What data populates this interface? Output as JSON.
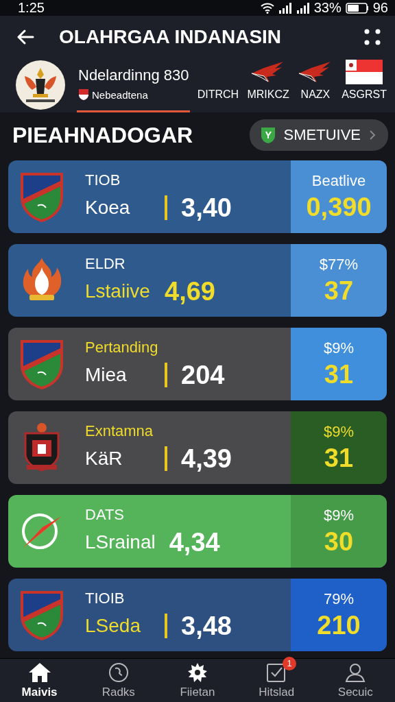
{
  "status_bar": {
    "time": "1:25",
    "battery": "33%",
    "extra": "96"
  },
  "header": {
    "title": "OLAHRGAA INDANASIN"
  },
  "tabs": [
    {
      "title": "Ndelardinng 830",
      "label": "Nebeadtena",
      "selected": true
    },
    {
      "label": "DITRCH",
      "selected": false
    },
    {
      "label": "MRIKCZ",
      "selected": false
    },
    {
      "label": "NAZX",
      "selected": false
    },
    {
      "label": "ASGRST",
      "selected": false
    }
  ],
  "section": {
    "title": "PIEAHNADOGAR",
    "button": "SMETUIVE"
  },
  "rows": [
    {
      "kind": "shield",
      "label": "TIOB",
      "name": "Koea",
      "score": "3,40",
      "color": "#2e5a8e",
      "divider": true,
      "label_highlight": false,
      "name_highlight": false,
      "score_highlight": false,
      "odds": {
        "label": "Beatlive",
        "value": "0,390",
        "color": "#4a8fd4",
        "label_highlight": false
      }
    },
    {
      "kind": "flame",
      "label": "ELDR",
      "name": "Lstaiive",
      "score": "4,69",
      "color": "#2e5a8e",
      "divider": false,
      "label_highlight": false,
      "name_highlight": true,
      "score_highlight": true,
      "odds": {
        "label": "$77%",
        "value": "37",
        "color": "#4a8fd4",
        "label_highlight": false
      }
    },
    {
      "kind": "shield",
      "label": "Pertanding",
      "name": "Miea",
      "score": "204",
      "color": "#4a4a4c",
      "divider": true,
      "label_highlight": true,
      "name_highlight": false,
      "score_highlight": false,
      "odds": {
        "label": "$9%",
        "value": "31",
        "color": "#3f8fdc",
        "label_highlight": false
      }
    },
    {
      "kind": "badge",
      "label": "Exntamna",
      "name": "KäR",
      "score": "4,39",
      "color": "#4a4a4c",
      "divider": true,
      "label_highlight": true,
      "name_highlight": false,
      "score_highlight": false,
      "odds": {
        "label": "$9%",
        "value": "31",
        "color": "#2a5d24",
        "label_highlight": true
      }
    },
    {
      "kind": "ball",
      "label": "DATS",
      "name": "LSrainal",
      "score": "4,34",
      "color": "#55b45a",
      "divider": false,
      "label_highlight": false,
      "name_highlight": false,
      "score_highlight": false,
      "odds": {
        "label": "$9%",
        "value": "30",
        "color": "#459b48",
        "label_highlight": false
      }
    },
    {
      "kind": "shield",
      "label": "TIOIB",
      "name": "LSeda",
      "score": "3,48",
      "color": "#2e5080",
      "divider": true,
      "label_highlight": false,
      "name_highlight": true,
      "score_highlight": false,
      "odds": {
        "label": "79%",
        "value": "210",
        "color": "#1f5fc8",
        "label_highlight": false
      }
    }
  ],
  "nav": [
    {
      "label": "Maivis",
      "selected": true
    },
    {
      "label": "Radks",
      "selected": false
    },
    {
      "label": "Fiietan",
      "selected": false
    },
    {
      "label": "Hitslad",
      "selected": false,
      "badge": "1"
    },
    {
      "label": "Secuic",
      "selected": false
    }
  ]
}
